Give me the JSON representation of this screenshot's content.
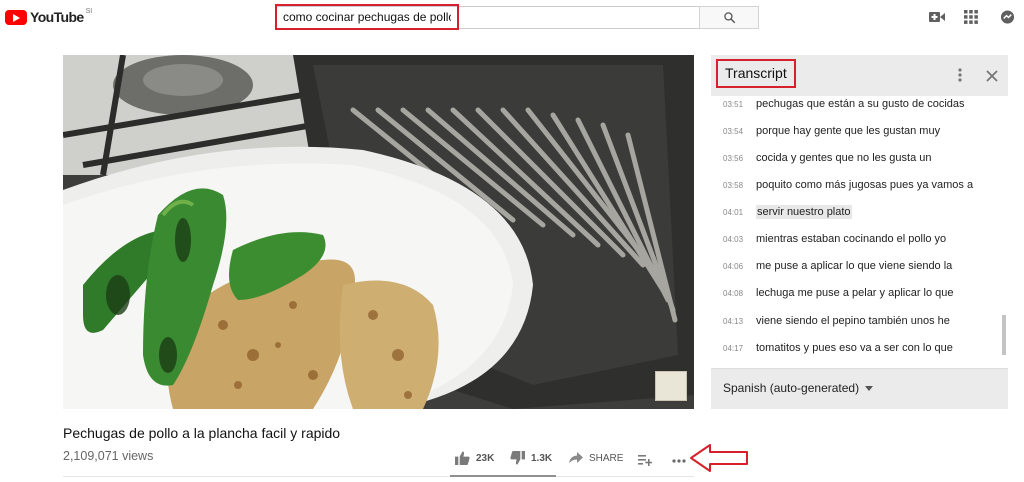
{
  "header": {
    "logo_text": "YouTube",
    "logo_region": "SI",
    "search_value": "como cocinar pechugas de pollo",
    "icons": [
      "search-icon",
      "video-upload-icon",
      "apps-icon",
      "messages-icon"
    ]
  },
  "video": {
    "title": "Pechugas de pollo a la plancha facil y rapido",
    "views": "2,109,071 views",
    "likes": "23K",
    "dislikes": "1.3K",
    "share_label": "SHARE"
  },
  "transcript": {
    "title": "Transcript",
    "language": "Spanish (auto-generated)",
    "lines": [
      {
        "time": "03:51",
        "text": "pechugas que están a su gusto de cocidas"
      },
      {
        "time": "03:54",
        "text": "porque hay gente que les gustan muy"
      },
      {
        "time": "03:56",
        "text": "cocida y gentes que no les gusta un"
      },
      {
        "time": "03:58",
        "text": "poquito como más jugosas pues ya vamos a"
      },
      {
        "time": "04:01",
        "text": "servir nuestro plato"
      },
      {
        "time": "04:03",
        "text": "mientras estaban cocinando el pollo yo"
      },
      {
        "time": "04:06",
        "text": "me puse a aplicar lo que viene siendo la"
      },
      {
        "time": "04:08",
        "text": "lechuga me puse a pelar y aplicar lo que"
      },
      {
        "time": "04:13",
        "text": "viene siendo el pepino también unos he"
      },
      {
        "time": "04:17",
        "text": "tomatitos y pues eso va a ser con lo que"
      }
    ],
    "active_index": 4
  },
  "colors": {
    "highlight_red": "#d6202b",
    "youtube_red": "#ff0000"
  }
}
